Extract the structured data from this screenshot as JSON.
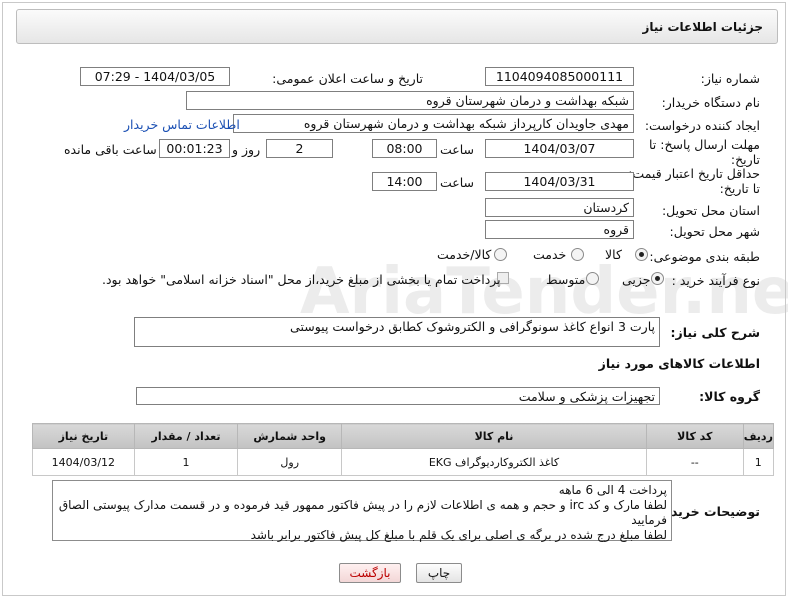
{
  "header": {
    "title": "جزئیات اطلاعات نیاز"
  },
  "form": {
    "need_number_label": "شماره نیاز:",
    "need_number": "1104094085000111",
    "announce_label": "تاریخ و ساعت اعلان عمومی:",
    "announce_value": "1404/03/05 - 07:29",
    "buyer_org_label": "نام دستگاه خریدار:",
    "buyer_org": "شبکه بهداشت و درمان شهرستان قروه",
    "requester_label": "ایجاد کننده درخواست:",
    "requester": "مهدی جاویدان کارپرداز شبکه بهداشت و درمان شهرستان قروه",
    "buyer_contact_link": "اطلاعات تماس خریدار",
    "reply_deadline_label": "مهلت ارسال پاسخ: تا تاریخ:",
    "reply_date": "1404/03/07",
    "time_label": "ساعت",
    "reply_time": "08:00",
    "days_value": "2",
    "days_label": "روز و",
    "remaining_time": "00:01:23",
    "remaining_label": "ساعت باقی مانده",
    "price_validity_label": "حداقل تاریخ اعتبار قیمت: تا تاریخ:",
    "validity_date": "1404/03/31",
    "validity_time": "14:00",
    "province_label": "استان محل تحویل:",
    "province": "کردستان",
    "city_label": "شهر محل تحویل:",
    "city": "قروه",
    "category_label": "طبقه بندی موضوعی:",
    "category_options": [
      "کالا",
      "خدمت",
      "کالا/خدمت"
    ],
    "category_selected": "کالا",
    "process_label": "نوع فرآیند خرید :",
    "process_options": [
      "جزیی",
      "متوسط"
    ],
    "process_selected": "جزیی",
    "payment_note": "پرداخت تمام یا بخشی از مبلغ خرید،از محل \"اسناد خزانه اسلامی\" خواهد بود."
  },
  "summary": {
    "label": "شرح کلی نیاز:",
    "text": "پارت 3 انواع کاغذ سونوگرافی و الکتروشوک کطابق درخواست پیوستی"
  },
  "goods": {
    "section_title": "اطلاعات کالاهای مورد نیاز",
    "group_label": "گروه کالا:",
    "group_value": "تجهیزات پزشکی و سلامت",
    "table": {
      "headers": [
        "ردیف",
        "کد کالا",
        "نام کالا",
        "واحد شمارش",
        "تعداد / مقدار",
        "تاریخ نیاز"
      ],
      "rows": [
        [
          "1",
          "--",
          "کاغذ الکتروکاردیوگراف EKG",
          "رول",
          "1",
          "1404/03/12"
        ]
      ]
    }
  },
  "notes": {
    "label": "توضیحات خریدار:",
    "line1": "پرداخت 4 الی 6 ماهه",
    "line2": "لطفا مارک و کد irc  و حجم و همه ی اطلاعات لازم را در پیش فاکتور ممهور قید فرموده و در قسمت مدارک پیوستی الصاق فرمایید",
    "line3": "لطفا مبلغ درج شده در برگه ی اصلی برای یک قلم با مبلغ کل پیش فاکتور برابر باشد"
  },
  "buttons": {
    "print": "چاپ",
    "back": "بازگشت"
  },
  "watermark": "AriaTender.net"
}
